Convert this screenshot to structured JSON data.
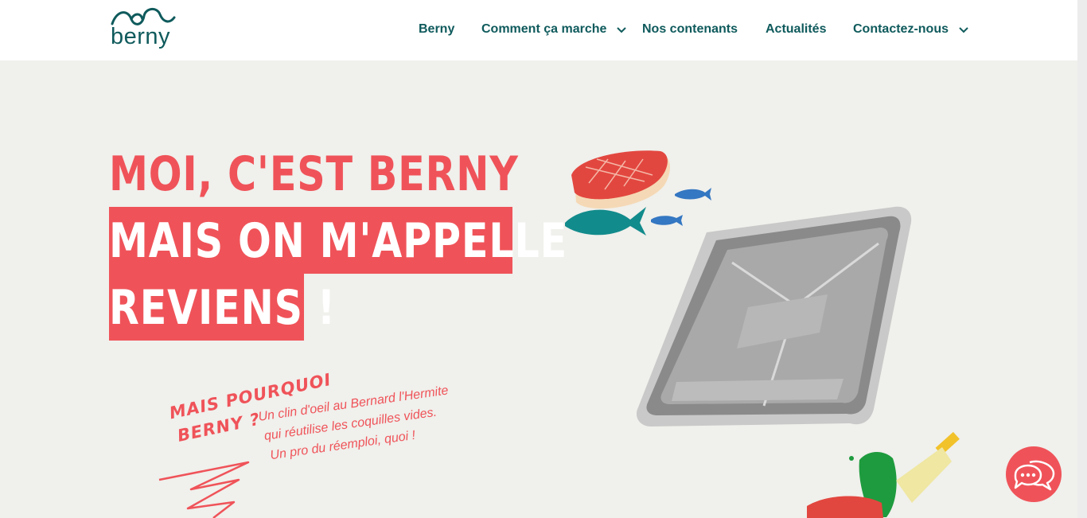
{
  "header": {
    "logo_text": "berny",
    "nav": [
      {
        "label": "Berny"
      },
      {
        "label": "Comment ça marche",
        "has_dropdown": true
      },
      {
        "label": "Nos contenants"
      },
      {
        "label": "Actualités"
      },
      {
        "label": "Contactez-nous",
        "has_dropdown": true
      }
    ]
  },
  "hero": {
    "line1": "MOI, C'EST BERNY",
    "line2": "MAIS ON M'APPELLE",
    "line3": "REVIENS !"
  },
  "why": {
    "title_line1": "MAIS POURQUOI",
    "title_line2": "BERNY ?",
    "text_line1": "Un clin d'oeil au Bernard l'Hermite",
    "text_line2": "qui réutilise les coquilles vides.",
    "text_line3": "Un pro du réemploi, quoi !"
  },
  "colors": {
    "accent": "#ef5359",
    "brand": "#0f5a5c",
    "background": "#f0f0ec"
  },
  "icons": {
    "chat": "chat-bubbles-icon",
    "dropdown": "chevron-down-icon"
  }
}
